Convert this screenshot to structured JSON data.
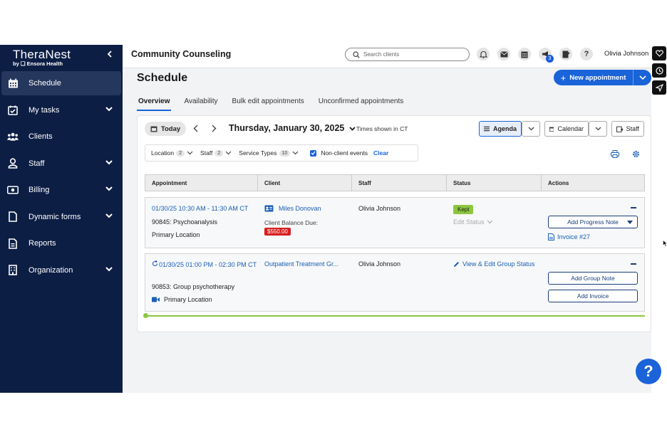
{
  "brand": {
    "name": "TheraNest",
    "sub": "by ❑ Ensora Health"
  },
  "sidebar": {
    "items": [
      {
        "label": "Schedule",
        "icon": "calendar-icon",
        "active": true,
        "expandable": false
      },
      {
        "label": "My tasks",
        "icon": "checklist-icon",
        "active": false,
        "expandable": true
      },
      {
        "label": "Clients",
        "icon": "people-icon",
        "active": false,
        "expandable": false
      },
      {
        "label": "Staff",
        "icon": "person-icon",
        "active": false,
        "expandable": true
      },
      {
        "label": "Billing",
        "icon": "money-icon",
        "active": false,
        "expandable": true
      },
      {
        "label": "Dynamic forms",
        "icon": "form-icon",
        "active": false,
        "expandable": true
      },
      {
        "label": "Reports",
        "icon": "report-icon",
        "active": false,
        "expandable": false
      },
      {
        "label": "Organization",
        "icon": "building-icon",
        "active": false,
        "expandable": true
      }
    ]
  },
  "header": {
    "org_name": "Community Counseling",
    "search_placeholder": "Search clients",
    "notification_count": "3",
    "user_name": "Olivia Johnson"
  },
  "page": {
    "title": "Schedule",
    "new_appointment_label": "New appointment",
    "tabs": [
      "Overview",
      "Availability",
      "Bulk edit appointments",
      "Unconfirmed appointments"
    ],
    "active_tab": "Overview"
  },
  "toolbar": {
    "today_label": "Today",
    "date_label": "Thursday, January 30, 2025",
    "timezone_note": "Times shown in CT",
    "view_agenda": "Agenda",
    "view_calendar": "Calendar",
    "view_staff": "Staff"
  },
  "filters": {
    "location_label": "Location",
    "location_count": "2",
    "staff_label": "Staff",
    "staff_count": "2",
    "service_label": "Service Types",
    "service_count": "10",
    "nonclient_label": "Non-client events",
    "nonclient_checked": true,
    "clear_label": "Clear"
  },
  "table": {
    "columns": [
      "Appointment",
      "Client",
      "Staff",
      "Status",
      "Actions"
    ],
    "rows": [
      {
        "time": "01/30/25 10:30 AM - 11:30 AM CT",
        "service": "90845: Psychoanalysis",
        "location": "Primary Location",
        "client": "Miles Donovan",
        "balance_label": "Client Balance Due:",
        "balance_amount": "$550.00",
        "staff": "Olivia Johnson",
        "status": "Kept",
        "edit_status": "Edit Status",
        "action_primary": "Add Progress Note",
        "action_secondary": "Invoice #27"
      },
      {
        "time": "01/30/25 01:00 PM - 02:30 PM CT",
        "service": "90853: Group psychotherapy",
        "location": "Primary Location",
        "client": "Outpatient Treatment Gr...",
        "staff": "Olivia Johnson",
        "status_link": "View & Edit Group Status",
        "action_primary": "Add Group Note",
        "action_secondary": "Add Invoice"
      }
    ]
  },
  "colors": {
    "sidebar_bg": "#0d1e45",
    "accent": "#1a63d8",
    "status_kept": "#8cc63f",
    "balance_due": "#d71e1e"
  }
}
